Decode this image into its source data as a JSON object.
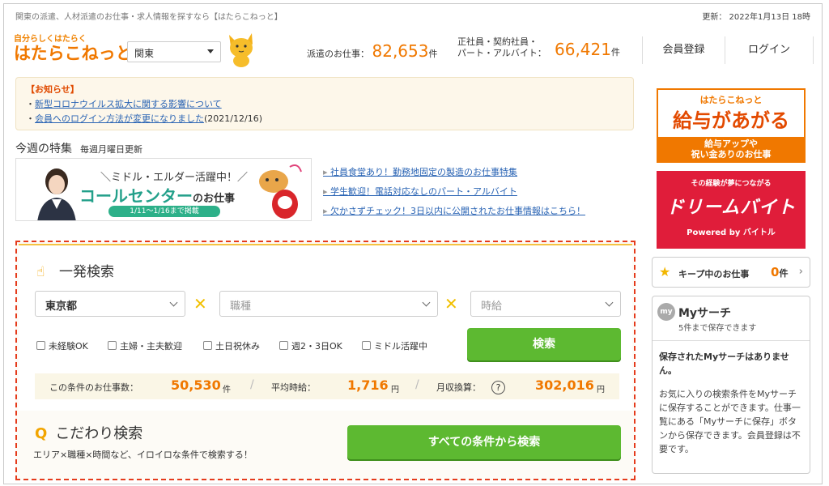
{
  "topbar": {
    "tagline": "関東の派遣、人材派遣のお仕事・求人情報を探すなら【はたらこねっと】",
    "updated": "更新： 2022年1月13日 18時"
  },
  "header": {
    "logo_sub": "自分らしくはたらく",
    "logo_main": "はたらこねっと",
    "region": "関東",
    "haken_label": "派遣のお仕事：",
    "haken_count": "82,653",
    "unit": "件",
    "seishain_label_1": "正社員・契約社員・",
    "seishain_label_2": "パート・アルバイト：",
    "seishain_count": "66,421",
    "register": "会員登録",
    "login": "ログイン"
  },
  "notice": {
    "title": "【お知らせ】",
    "items": [
      {
        "text": "新型コロナウイルス拡大に関する影響について",
        "suffix": ""
      },
      {
        "text": "会員へのログイン方法が変更になりました",
        "suffix": "(2021/12/16)"
      }
    ]
  },
  "feature": {
    "title": "今週の特集",
    "sub": "毎週月曜日更新",
    "banner_line1": "＼ミドル・エルダー活躍中！／",
    "banner_main": "コールセンター",
    "banner_suffix": "のお仕事",
    "banner_period": "1/11～1/16まで掲載",
    "links": [
      "社員食堂あり！勤務地固定の製造のお仕事特集",
      "学生歓迎！電話対応なしのパート・アルバイト",
      "欠かさずチェック！3日以内に公開されたお仕事情報はこちら！"
    ]
  },
  "search": {
    "title": "一発検索",
    "pref": "東京都",
    "job": "職種",
    "pay": "時給",
    "checks": [
      "未経験OK",
      "主婦・主夫歓迎",
      "土日祝休み",
      "週2・3日OK",
      "ミドル活躍中"
    ],
    "button": "検索",
    "count_label": "この条件のお仕事数：",
    "count": "50,530",
    "count_unit": "件",
    "avg_label": "平均時給：",
    "avg": "1,716",
    "yen": "円",
    "monthly_label": "月収換算：",
    "monthly": "302,016",
    "q": "?"
  },
  "kodawari": {
    "title": "こだわり検索",
    "sub": "エリア×職種×時間など、イロイロな条件で検索する！",
    "button": "すべての条件から検索"
  },
  "ads": {
    "ad1_top": "はたらこねっと",
    "ad1_main": "給与があがる",
    "ad1_sub1": "給与アップや",
    "ad1_sub2": "祝い金ありのお仕事",
    "ad2_top": "その経験が夢につながる",
    "ad2_main": "ドリームバイト",
    "ad2_sub": "Powered by バイトル"
  },
  "keep": {
    "label": "キープ中のお仕事",
    "count": "0",
    "unit": "件"
  },
  "mysearch": {
    "badge": "my",
    "title": "Myサーチ",
    "sub": "5件まで保存できます",
    "empty": "保存されたMyサーチはありません。",
    "desc": "お気に入りの検索条件をMyサーチに保存することができます。仕事一覧にある「Myサーチに保存」ボタンから保存できます。会員登録は不要です。"
  },
  "colors": {
    "accent": "#f07800",
    "green": "#5db931",
    "dashed": "#e53b1c",
    "link": "#2a64b4"
  }
}
